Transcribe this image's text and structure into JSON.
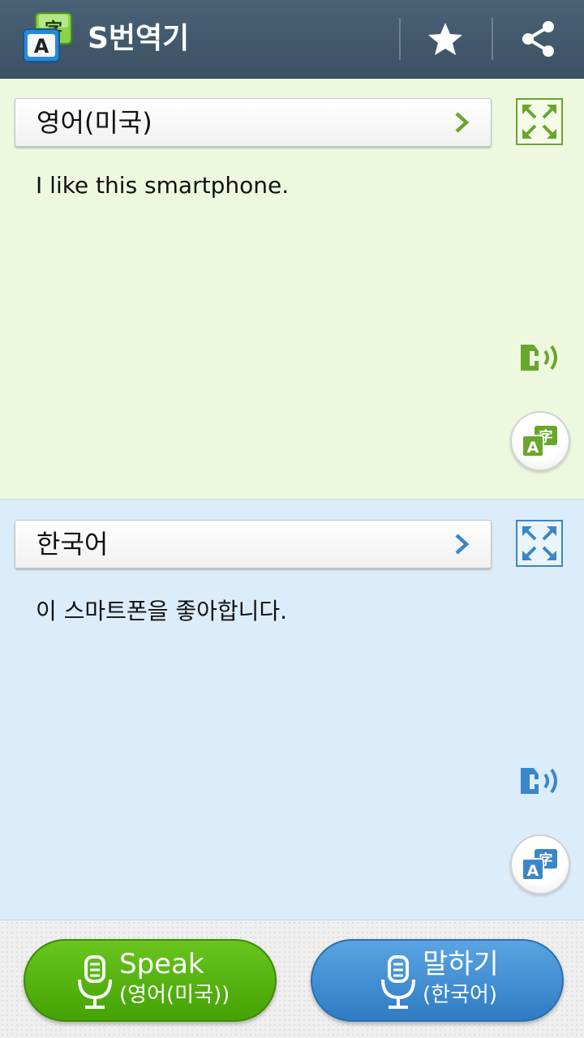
{
  "app": {
    "title": "S번역기",
    "icon_glyph_back": "字",
    "icon_glyph_front": "A",
    "actions": [
      "star-icon",
      "share-icon"
    ]
  },
  "source": {
    "language": "영어(미국)",
    "text": "I like this smartphone.",
    "accent_color": "#6aa52c"
  },
  "target": {
    "language": "한국어",
    "text": "이 스마트폰을 좋아합니다.",
    "accent_color": "#3a86c8"
  },
  "bottom": {
    "left_button": {
      "main": "Speak",
      "sub": "(영어(미국))"
    },
    "right_button": {
      "main": "말하기",
      "sub": "(한국어)"
    }
  },
  "converter_glyphs": {
    "latin": "A",
    "cjk": "字"
  }
}
